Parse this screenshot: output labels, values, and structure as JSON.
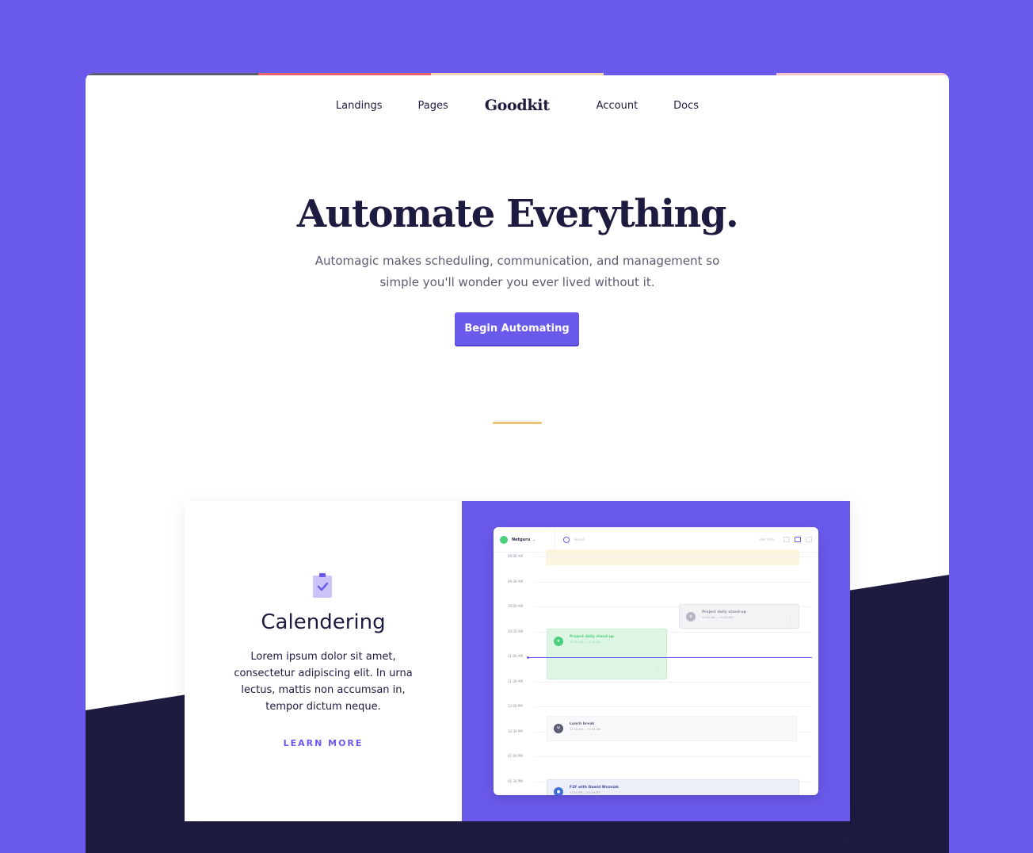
{
  "nav": {
    "items": [
      "Landings",
      "Pages",
      "Account",
      "Docs"
    ],
    "logo": "Goodkit"
  },
  "hero": {
    "title_part1": "Automate ",
    "title_highlight": "Everything",
    "title_end": ".",
    "subtitle_line1": "Automagic makes scheduling, communication, and management so",
    "subtitle_line2": "simple you'll wonder you ever lived without it.",
    "cta": "Begin Automating"
  },
  "feature": {
    "icon": "clipboard-check-icon",
    "title": "Calendering",
    "text": "Lorem ipsum dolor sit amet, consectetur adipiscing elit. In urna lectus, mattis non accumsan in, tempor dictum neque.",
    "link": "LEARN MORE"
  },
  "app": {
    "org": "Netguru",
    "search_placeholder": "Search",
    "tool_text": "Add item",
    "times": [
      "09:00 AM",
      "09:30 AM",
      "10:00 AM",
      "10:30 AM",
      "11:00 AM",
      "11:30 AM",
      "12:00 PM",
      "12:30 PM",
      "01:00 PM",
      "01:30 PM"
    ],
    "events": [
      {
        "title": "Project daily stand-up",
        "time": "10:00 AM — 10:30 AM"
      },
      {
        "title": "Project daily stand-up",
        "time": "10:30 AM — 11:30 AM"
      },
      {
        "title": "Lunch break",
        "time": "12:30 AM — 12:45 AM"
      },
      {
        "title": "F2F with Dawid Wozniak",
        "time": "01:30 PM — 02:00 PM"
      }
    ]
  },
  "colors": {
    "background": "#6a5aeb",
    "accent": "#6a5aeb",
    "dark": "#1d1b3f",
    "highlight": "#f5dcaf",
    "divider": "#f0c27a"
  }
}
